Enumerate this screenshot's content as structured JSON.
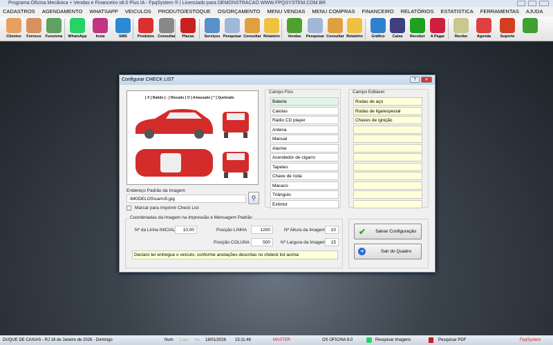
{
  "window": {
    "title": "Programa Oficina Mecânica + Vendas e Financeiro v8.0 Plus IA - FpqSystem ® | Licenciado para  DEMONSTRACAO WWW.FPQSYSTEM.COM.BR"
  },
  "menu": [
    "CADASTROS",
    "AGENDAMENTO",
    "WHATSAPP",
    "VEICULOS",
    "PRODUTO/ESTOQUE",
    "OS/ORÇAMENTO",
    "MENU VENDAS",
    "MENU COMPRAS",
    "FINANCEIRO",
    "RELATÓRIOS",
    "ESTATISTICA",
    "FERRAMENTAS",
    "AJUDA"
  ],
  "toolbar": [
    {
      "label": "Clientes",
      "icon": "clients-icon",
      "color": "#e8a060"
    },
    {
      "label": "Fornece",
      "icon": "supplier-icon",
      "color": "#d89060"
    },
    {
      "label": "Funciona",
      "icon": "employee-icon",
      "color": "#60a060"
    },
    {
      "label": "WhatsApp",
      "icon": "whatsapp-icon",
      "color": "#25d366"
    },
    {
      "label": "Insta",
      "icon": "instagram-icon",
      "color": "#c13584"
    },
    {
      "label": "SMS",
      "icon": "sms-icon",
      "color": "#2a8ad8"
    },
    {
      "label": "Produtos",
      "icon": "products-icon",
      "color": "#d83030"
    },
    {
      "label": "Consultar",
      "icon": "barcode-icon",
      "color": "#888888"
    },
    {
      "label": "Placas",
      "icon": "car-plate-icon",
      "color": "#c82020"
    },
    {
      "label": "Serviços",
      "icon": "services-icon",
      "color": "#5a90c8"
    },
    {
      "label": "Pesquisar",
      "icon": "search-docs-icon",
      "color": "#a0b8d8"
    },
    {
      "label": "Consultar",
      "icon": "drawer-icon",
      "color": "#e0a040"
    },
    {
      "label": "Relatório",
      "icon": "printer-icon",
      "color": "#f0c040"
    },
    {
      "label": "Vendas",
      "icon": "cart-icon",
      "color": "#50a030"
    },
    {
      "label": "Pesquisar",
      "icon": "search-docs-icon",
      "color": "#a0b8d8"
    },
    {
      "label": "Consultar",
      "icon": "drawer-icon",
      "color": "#e0a040"
    },
    {
      "label": "Relatório",
      "icon": "printer-icon",
      "color": "#f0c040"
    },
    {
      "label": "Gráfico",
      "icon": "chart-icon",
      "color": "#3080d0"
    },
    {
      "label": "Caixa",
      "icon": "cash-book-icon",
      "color": "#404080"
    },
    {
      "label": "Receber",
      "icon": "receive-money-icon",
      "color": "#20a020"
    },
    {
      "label": "A Pagar",
      "icon": "pay-money-icon",
      "color": "#d02040"
    },
    {
      "label": "Recibo",
      "icon": "receipt-icon",
      "color": "#c8c890"
    },
    {
      "label": "Agenda",
      "icon": "calendar-icon",
      "color": "#e04040"
    },
    {
      "label": "Suporte",
      "icon": "support-icon",
      "color": "#d04020"
    },
    {
      "label": "",
      "icon": "exit-icon",
      "color": "#40a030"
    }
  ],
  "dialog": {
    "title": "Configurar CHECK LIST",
    "legend": "[ X ] Batido   [ - ] Riscado   [ O ] Amassado   [ * ] Quebrado",
    "image_label": "Endereço Padrão da Imagem",
    "image_path": ".\\MODELOS\\carro5.jpg",
    "print_checkbox": "Marcar para Imprimir Check List",
    "print_checked": false,
    "fixed_header": "Campo Fixo",
    "fixed": [
      "Bateria",
      "Calotas",
      "Rádio CD player",
      "Antena",
      "Manual",
      "Alarme",
      "Acendedor de cigarro",
      "Tapetes",
      "Chave de roda",
      "Macaco",
      "Triângulo",
      "Extintor"
    ],
    "editable_header": "Campo Editável",
    "editable": [
      "Rodas de aço",
      "Rodas de liga/especial",
      "Chaves de ignição",
      "",
      "",
      "",
      "",
      "",
      "",
      "",
      "",
      ""
    ],
    "coords_group": "Coordenadas da Imagem na Impressão e Mensagem Padrão",
    "linha_inicial_label": "Nº da Linha INICIAL",
    "linha_inicial": "10,00",
    "pos_linha_label": "Posição LINHA",
    "pos_linha": "1200",
    "pos_coluna_label": "Posição COLUNA",
    "pos_coluna": "500",
    "altura_label": "Nº Altura da Imagem",
    "altura": "10",
    "largura_label": "Nº Largura da Imagem",
    "largura": "15",
    "message": "Declaro ter entregue o veículo, conforme anotações descritas no chdeck list acima:",
    "save": "Salvar Configuração",
    "exit": "Sair do Quadro"
  },
  "status": {
    "location": "DUQUE DE CAXIAS - RJ 18 de Janeiro de 2026 - Domingo",
    "num": "Num",
    "caps": "Caps",
    "ins": "Ins",
    "date": "18/01/2026",
    "time": "15:11:46",
    "user": "MASTER",
    "version": "OS OFICINA 8.0",
    "search_images": "Pesquisar Imagens",
    "search_pdf": "Pesquisar PDF",
    "brand": "FpqSystem"
  }
}
